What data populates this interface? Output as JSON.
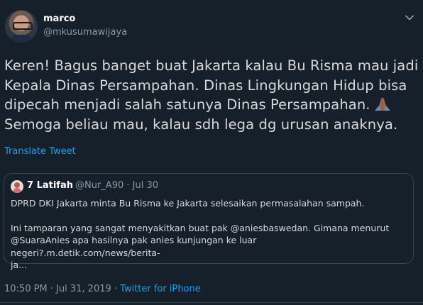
{
  "author": {
    "name": "marco",
    "handle": "@mkusumawijaya"
  },
  "tweet": {
    "lines": [
      "Keren! Bagus banget buat Jakarta kalau Bu Risma mau jadi",
      "Kepala Dinas Persampahan. Dinas Lingkungan Hidup bisa",
      "dipecah menjadi salah satunya Dinas Persampahan.",
      "Semoga beliau mau, kalau sdh lega dg urusan anaknya."
    ],
    "emoji": "folded-hands-emoji",
    "translate_label": "Translate Tweet"
  },
  "quote": {
    "name": "7 Latifah",
    "meta": "@Nur_A90 · Jul 30",
    "paragraph1": "DPRD DKI Jakarta minta Bu Risma ke Jakarta selesaikan permasalahan sampah.",
    "paragraph2_lines": [
      "Ini tamparan yang sangat menyakitkan buat pak @aniesbaswedan. Gimana menurut",
      "@SuaraAnies apa hasilnya pak anies kunjungan ke luar negeri?.m.detik.com/news/berita-",
      "ja..."
    ]
  },
  "footer": {
    "timestamp": "10:50 PM · Jul 31, 2019 · ",
    "source": "Twitter for iPhone"
  },
  "icons": {
    "menu": "chevron-down-icon"
  },
  "colors": {
    "background": "#15202b",
    "link": "#1da1f2",
    "secondary_text": "#8899a6",
    "border": "#38444d"
  }
}
